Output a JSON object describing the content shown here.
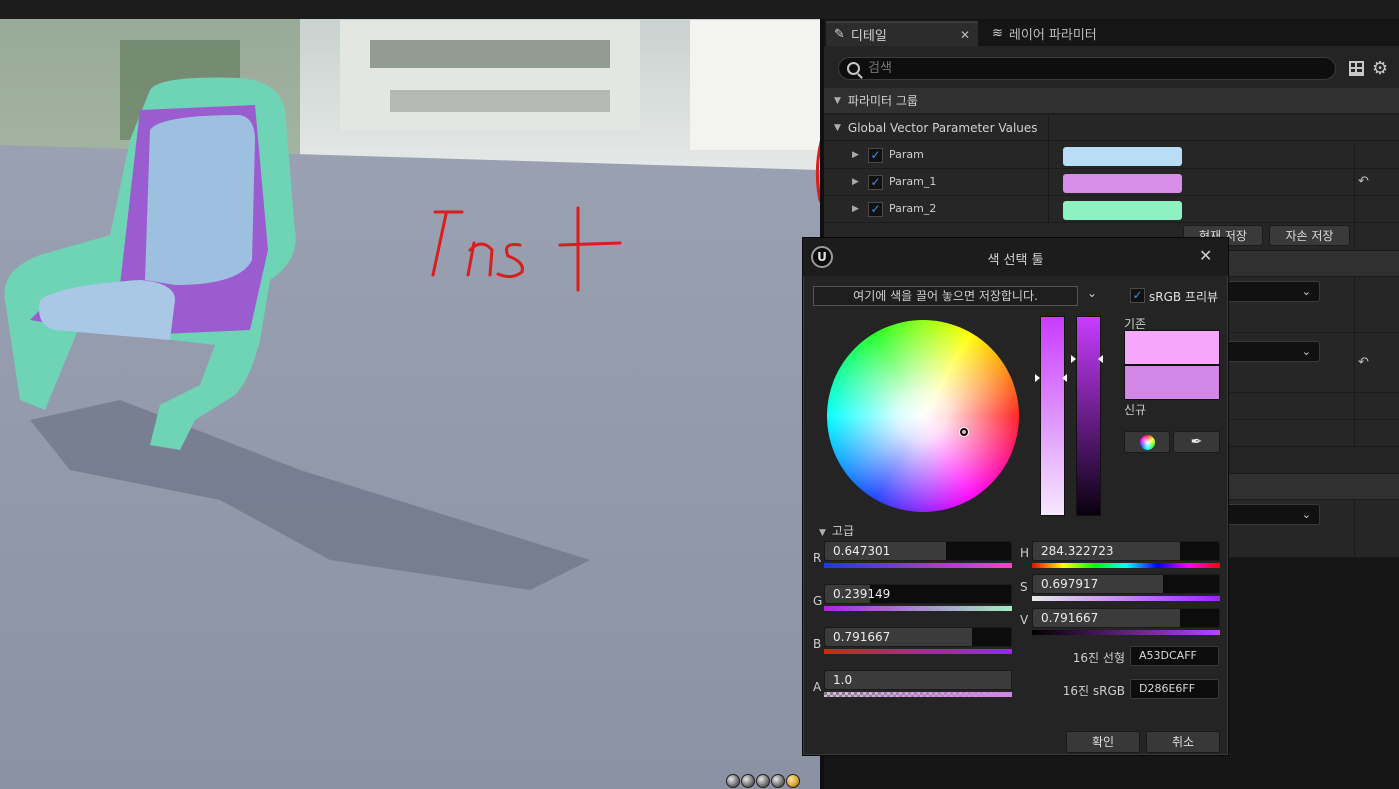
{
  "tabs": {
    "details_label": "디테일",
    "layer_params_label": "레이어 파라미터"
  },
  "search": {
    "placeholder": "검색"
  },
  "sections": {
    "param_group": "파라미터 그룹",
    "global_vector": "Global Vector Parameter Values"
  },
  "params": [
    {
      "label": "Param",
      "checked": true,
      "color": "#b9ddf5"
    },
    {
      "label": "Param_1",
      "checked": true,
      "color": "#d88ee8"
    },
    {
      "label": "Param_2",
      "checked": true,
      "color": "#8ef2c0"
    }
  ],
  "buttons": {
    "save_current": "현재 저장",
    "save_child": "자손 저장"
  },
  "viewport": {
    "annotation_text": "inst",
    "annotation_color": "#d81e1e"
  },
  "picker": {
    "title": "색 선택 툴",
    "swatch_drop_text": "여기에 색을 끌어 놓으면 저장합니다.",
    "srgb_preview_label": "sRGB 프리뷰",
    "srgb_preview_checked": true,
    "old_label": "기존",
    "new_label": "신규",
    "old_color": "#f5a8fb",
    "new_color": "#d286e6",
    "advanced_label": "고급",
    "channels": {
      "r": {
        "label": "R",
        "value": "0.647301",
        "fraction": 0.647301
      },
      "g": {
        "label": "G",
        "value": "0.239149",
        "fraction": 0.239149
      },
      "b": {
        "label": "B",
        "value": "0.791667",
        "fraction": 0.791667
      },
      "a": {
        "label": "A",
        "value": "1.0",
        "fraction": 1.0
      },
      "h": {
        "label": "H",
        "value": "284.322723",
        "fraction": 0.7898
      },
      "s": {
        "label": "S",
        "value": "0.697917",
        "fraction": 0.697917
      },
      "v": {
        "label": "V",
        "value": "0.791667",
        "fraction": 0.791667
      }
    },
    "hex_linear_label": "16진 선형",
    "hex_linear": "A53DCAFF",
    "hex_srgb_label": "16진 sRGB",
    "hex_srgb": "D286E6FF",
    "ok_label": "확인",
    "cancel_label": "취소"
  }
}
